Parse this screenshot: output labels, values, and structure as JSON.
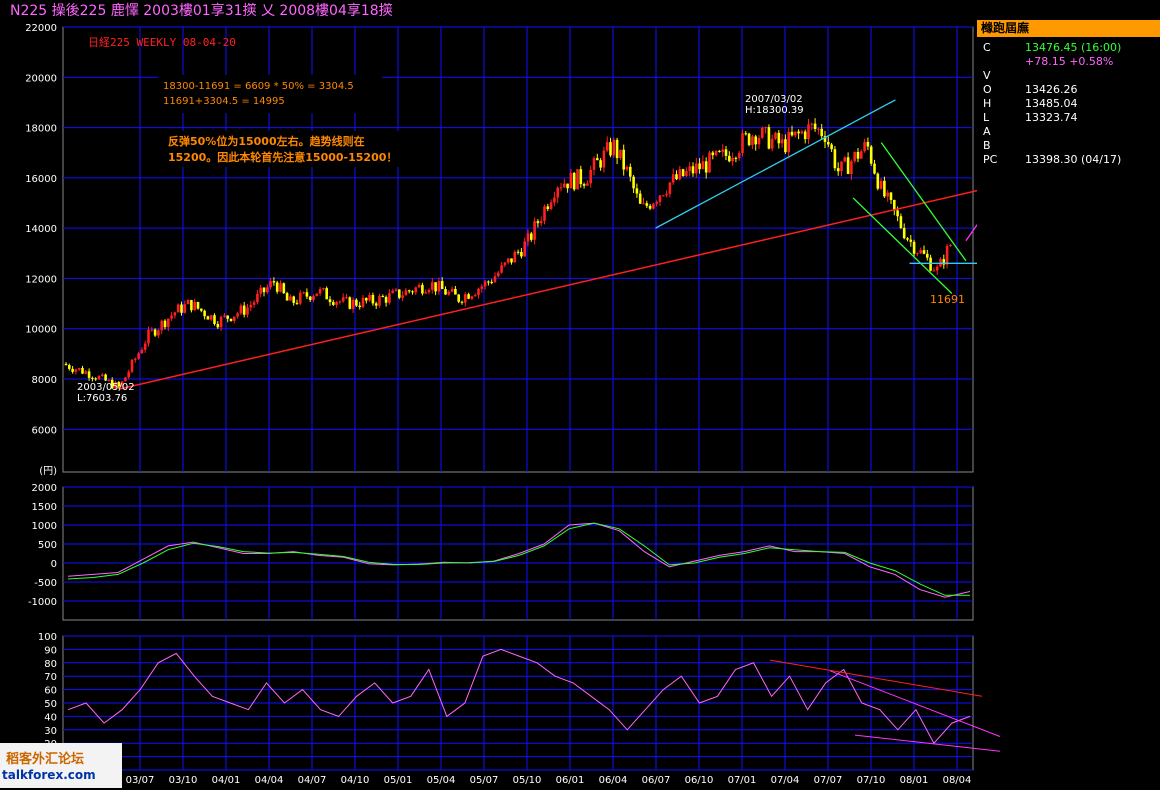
{
  "header": {
    "text": "N225  操後225  鹿懌  2003樓01享31擌 乂 2008樓04享18擌"
  },
  "panel": {
    "title": "橼跑屆廡",
    "rows": [
      {
        "label": "C",
        "value": "13476.45 (16:00)"
      },
      {
        "label": "",
        "value": "+78.15 +0.58%"
      },
      {
        "label": "V",
        "value": ""
      },
      {
        "label": "O",
        "value": "13426.26"
      },
      {
        "label": "H",
        "value": "13485.04"
      },
      {
        "label": "L",
        "value": "13323.74"
      },
      {
        "label": "A",
        "value": ""
      },
      {
        "label": "B",
        "value": ""
      },
      {
        "label": "PC",
        "value": "13398.30 (04/17)"
      }
    ]
  },
  "watermark": {
    "line1": "稻客外汇论坛",
    "line2": "talkforex.com"
  },
  "colors": {
    "grid": "#1010ff",
    "up_candle": "#ff2020",
    "down_candle": "#ffff00",
    "trendline": "#ff2020",
    "cyan_line": "#33ccee",
    "green_line": "#33ff33",
    "macd1": "#ff66ff",
    "macd2": "#33ff33",
    "rsi": "#ff66ff",
    "annotation": "#ff8800"
  },
  "chart_data": [
    {
      "type": "candlestick",
      "title": "日経225  WEEKLY   08-04-20",
      "ylabel": "(円)",
      "ylim": [
        4300,
        22000
      ],
      "yticks": [
        6000,
        8000,
        10000,
        12000,
        14000,
        16000,
        18000,
        20000,
        22000
      ],
      "grid": true,
      "x_ticks": [
        "03/07",
        "03/10",
        "04/01",
        "04/04",
        "04/07",
        "04/10",
        "05/01",
        "05/04",
        "05/07",
        "05/10",
        "06/01",
        "06/04",
        "06/07",
        "06/10",
        "07/01",
        "07/04",
        "07/07",
        "07/10",
        "08/01",
        "08/04"
      ],
      "close_path": [
        [
          "2003/01",
          8600
        ],
        [
          "2003/03",
          8200
        ],
        [
          "2003/05",
          7650
        ],
        [
          "2003/07",
          9700
        ],
        [
          "2003/09",
          10700
        ],
        [
          "2003/10",
          11000
        ],
        [
          "2003/12",
          10300
        ],
        [
          "2004/02",
          10800
        ],
        [
          "2004/04",
          11900
        ],
        [
          "2004/05",
          11000
        ],
        [
          "2004/07",
          11500
        ],
        [
          "2004/09",
          11000
        ],
        [
          "2004/11",
          11100
        ],
        [
          "2005/01",
          11400
        ],
        [
          "2005/03",
          11800
        ],
        [
          "2005/05",
          11200
        ],
        [
          "2005/07",
          11800
        ],
        [
          "2005/08",
          12300
        ],
        [
          "2005/10",
          13500
        ],
        [
          "2005/12",
          15800
        ],
        [
          "2006/02",
          16000
        ],
        [
          "2006/04",
          17300
        ],
        [
          "2006/05",
          16200
        ],
        [
          "2006/06",
          14700
        ],
        [
          "2006/08",
          15800
        ],
        [
          "2006/10",
          16400
        ],
        [
          "2006/12",
          16900
        ],
        [
          "2007/02",
          17800
        ],
        [
          "2007/04",
          17300
        ],
        [
          "2007/06",
          18000
        ],
        [
          "2007/07",
          17800
        ],
        [
          "2007/08",
          16200
        ],
        [
          "2007/10",
          17300
        ],
        [
          "2007/11",
          15500
        ],
        [
          "2008/01",
          13500
        ],
        [
          "2008/03",
          12300
        ],
        [
          "2008/04",
          13476
        ]
      ],
      "annotations": [
        {
          "text": "2003/05/02",
          "sub": "L:7603.76"
        },
        {
          "text": "2007/03/02",
          "sub": "H:18300.39"
        },
        {
          "text": "11691"
        },
        {
          "text": "18300-11691 = 6609 * 50% = 3304.5"
        },
        {
          "text": "11691+3304.5 = 14995"
        },
        {
          "text": "反弹50%位为15000左右。趋势线则在"
        },
        {
          "text": "15200。因此本轮首先注意15000-15200！"
        }
      ]
    },
    {
      "type": "line",
      "ylim": [
        -1500,
        2000
      ],
      "yticks": [
        -1000,
        -500,
        0,
        500,
        1000,
        1500,
        2000
      ],
      "series": [
        {
          "values": [
            -350,
            -300,
            -250,
            100,
            450,
            550,
            400,
            250,
            250,
            300,
            200,
            150,
            -20,
            -50,
            -30,
            20,
            0,
            50,
            250,
            500,
            1000,
            1050,
            850,
            300,
            -100,
            50,
            200,
            300,
            450,
            300,
            300,
            250,
            -100,
            -300,
            -700,
            -900,
            -750
          ]
        },
        {
          "values": [
            -420,
            -380,
            -300,
            0,
            350,
            520,
            430,
            300,
            260,
            280,
            230,
            170,
            20,
            -40,
            -40,
            0,
            10,
            40,
            200,
            450,
            900,
            1050,
            900,
            450,
            -50,
            0,
            150,
            250,
            400,
            350,
            300,
            280,
            0,
            -200,
            -550,
            -850,
            -850
          ]
        }
      ]
    },
    {
      "type": "line",
      "ylim": [
        0,
        100
      ],
      "yticks": [
        0,
        10,
        20,
        30,
        40,
        50,
        60,
        70,
        80,
        90,
        100
      ],
      "series": [
        {
          "values": [
            45,
            50,
            35,
            45,
            60,
            80,
            87,
            70,
            55,
            50,
            45,
            65,
            50,
            60,
            45,
            40,
            55,
            65,
            50,
            55,
            75,
            40,
            50,
            85,
            90,
            85,
            80,
            70,
            65,
            55,
            45,
            30,
            45,
            60,
            70,
            50,
            55,
            75,
            80,
            55,
            70,
            45,
            65,
            75,
            50,
            45,
            30,
            45,
            20,
            35,
            40
          ]
        }
      ]
    }
  ]
}
